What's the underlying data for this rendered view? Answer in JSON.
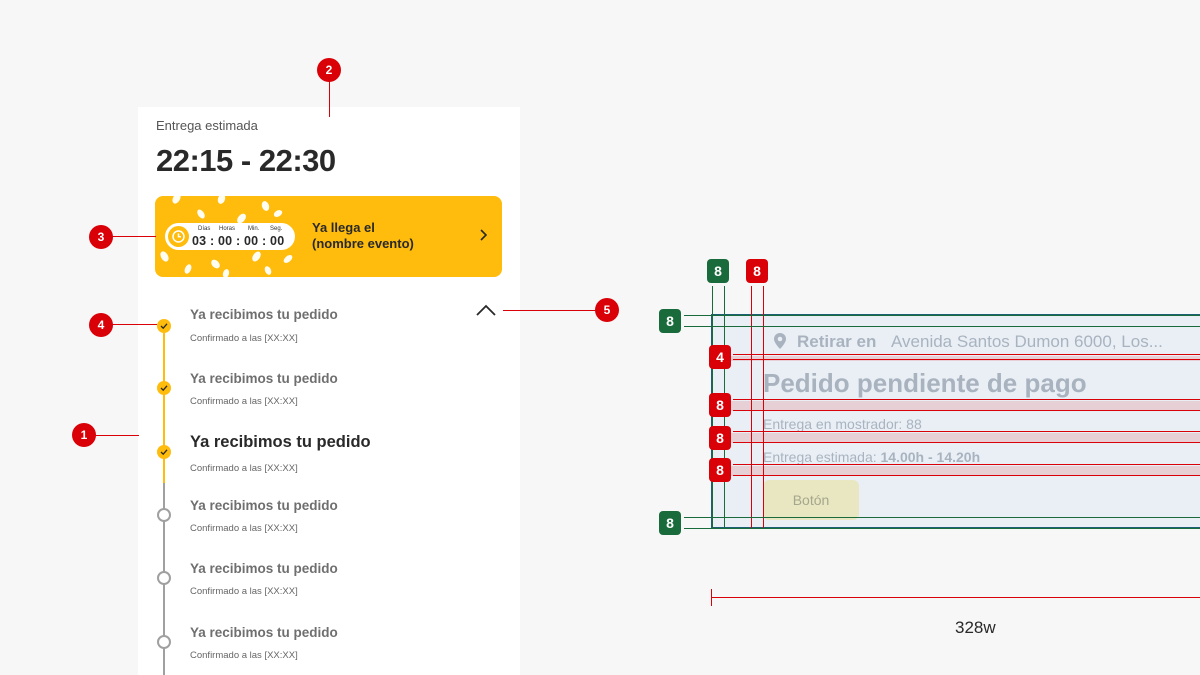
{
  "card": {
    "estimate_label": "Entrega estimada",
    "estimate_time": "22:15 - 22:30",
    "banner": {
      "background_color": "#ffbc0d",
      "countdown": {
        "units": [
          "Días",
          "Horas",
          "Min.",
          "Seg."
        ],
        "digits": "03 : 00 : 00 : 00"
      },
      "title_line1": "Ya llega el",
      "title_line2": "(nombre evento)",
      "icon": "chevron-right-icon"
    },
    "collapse_icon": "chevron-up-icon",
    "steps": [
      {
        "title": "Ya recibimos tu pedido",
        "subtitle": "Confirmado a las [XX:XX]",
        "state": "done"
      },
      {
        "title": "Ya recibimos tu pedido",
        "subtitle": "Confirmado a las [XX:XX]",
        "state": "done"
      },
      {
        "title": "Ya recibimos tu pedido",
        "subtitle": "Confirmado a las [XX:XX]",
        "state": "current"
      },
      {
        "title": "Ya recibimos tu pedido",
        "subtitle": "Confirmado a las [XX:XX]",
        "state": "pending"
      },
      {
        "title": "Ya recibimos tu pedido",
        "subtitle": "Confirmado a las [XX:XX]",
        "state": "pending"
      },
      {
        "title": "Ya recibimos tu pedido",
        "subtitle": "Confirmado a las [XX:XX]",
        "state": "pending"
      }
    ]
  },
  "callouts": [
    "1",
    "2",
    "3",
    "4",
    "5"
  ],
  "spec": {
    "retirar_label": "Retirar en",
    "address": "Avenida Santos Dumon 6000, Los...",
    "title": "Pedido pendiente de pago",
    "line1": "Entrega en mostrador: 88",
    "line2_label": "Entrega estimada:",
    "line2_value": "14.00h - 14.20h",
    "button": "Botón",
    "badges": {
      "top_green": "8",
      "top_red": "8",
      "left_top": "8",
      "gap_4": "4",
      "gap_8_a": "8",
      "gap_8_b": "8",
      "gap_8_c": "8",
      "left_bottom": "8"
    },
    "width_label": "328w",
    "colors": {
      "accent_red": "#d90007",
      "accent_green": "#1a6b3c",
      "frame": "#1d5f74"
    }
  }
}
